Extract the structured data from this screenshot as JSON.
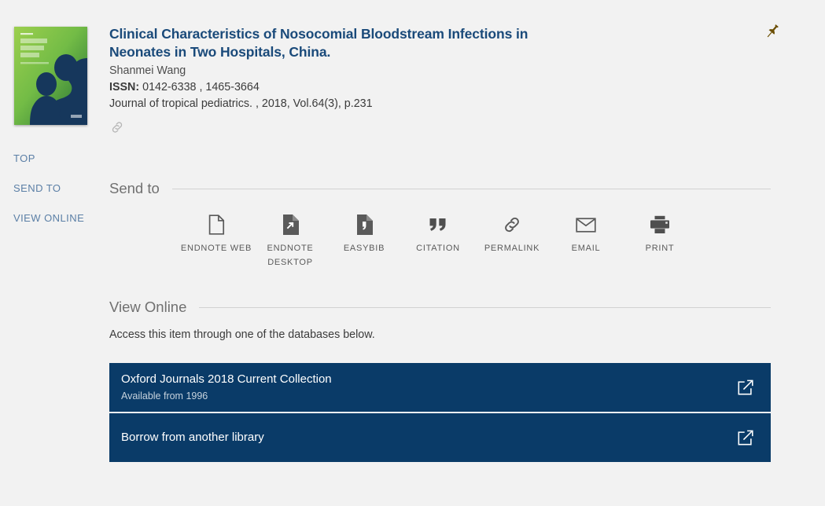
{
  "record": {
    "pin_label": "pin-icon",
    "title": "Clinical Characteristics of Nosocomial Bloodstream Infections in Neonates in Two Hospitals, China.",
    "author": "Shanmei Wang",
    "issn_label": "ISSN:",
    "issn_value": " 0142-6338 , 1465-3664",
    "source": "Journal of tropical pediatrics. , 2018, Vol.64(3), p.231",
    "cover_alt": "Journal of Tropical Pediatrics",
    "cover_colors": {
      "green_light": "#8cc63f",
      "green_dark": "#2f7d32",
      "silhouette": "#13365c"
    }
  },
  "left_nav": {
    "items": [
      {
        "label": "TOP",
        "name": "nav-top"
      },
      {
        "label": "SEND TO",
        "name": "nav-send-to"
      },
      {
        "label": "VIEW ONLINE",
        "name": "nav-view-online"
      }
    ]
  },
  "send_to": {
    "heading": "Send to",
    "items": [
      {
        "icon": "document-outline-icon",
        "label": "ENDNOTE WEB"
      },
      {
        "icon": "document-export-icon",
        "label": "ENDNOTE DESKTOP"
      },
      {
        "icon": "document-quote-icon",
        "label": "EASYBIB"
      },
      {
        "icon": "quote-icon",
        "label": "CITATION"
      },
      {
        "icon": "link-icon",
        "label": "PERMALINK"
      },
      {
        "icon": "envelope-icon",
        "label": "EMAIL"
      },
      {
        "icon": "printer-icon",
        "label": "PRINT"
      }
    ]
  },
  "view_online": {
    "heading": "View Online",
    "note": "Access this item through one of the databases below.",
    "databases": [
      {
        "title": "Oxford Journals 2018 Current Collection",
        "subtitle": "Available from 1996",
        "icon": "external-link-icon"
      },
      {
        "title": "Borrow from another library",
        "subtitle": "",
        "icon": "external-link-icon"
      }
    ]
  },
  "theme": {
    "page_bg": "#f2f2f2",
    "accent_blue": "#0a3b68",
    "title_blue": "#1a4a7a",
    "nav_blue": "#5b7fa6",
    "pin_brown": "#6b4e00"
  }
}
